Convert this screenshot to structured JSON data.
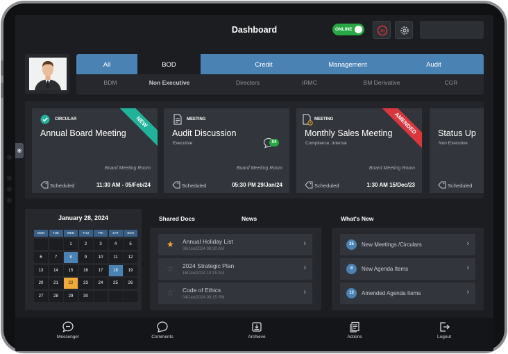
{
  "header": {
    "title": "Dashboard",
    "status_label": "ONLINE"
  },
  "filters": {
    "tabs": [
      "All",
      "BOD",
      "Credit",
      "Management",
      "Audit"
    ],
    "active_tab": "BOD",
    "subtabs": [
      "BDM",
      "Non Executive",
      "Directors",
      "IRMC",
      "BM Derivative",
      "CGR"
    ],
    "active_subtab": "Non Executive"
  },
  "cards": [
    {
      "type": "CIRCULAR",
      "title": "Annual Board Meeting",
      "subtitle": "",
      "room": "Board Meeting Room",
      "status": "Scheduled",
      "datetime": "11:30 AM - 05/Feb/24",
      "ribbon": "NEW",
      "ribbon_color": "#20b39a"
    },
    {
      "type": "MEETING",
      "title": "Audit Discussion",
      "subtitle": "Executive",
      "room": "Board Meeting Room",
      "status": "Scheduled",
      "datetime": "05:30 PM 29/Jan/24",
      "comment_count": "04"
    },
    {
      "type": "MEETING",
      "title": "Monthly Sales Meeting",
      "subtitle": "Compliance, Internal",
      "room": "Board Meeting Room",
      "status": "Scheduled",
      "datetime": "1:30 AM 15/Dec/23",
      "ribbon": "AMENDED",
      "ribbon_color": "#d9363e"
    },
    {
      "type": "",
      "title": "Status Up",
      "subtitle": "Non Executive",
      "room": "",
      "status": "Scheduled",
      "datetime": ""
    }
  ],
  "calendar": {
    "title": "January 28, 2024",
    "weekdays": [
      "MON",
      "TUE",
      "WED",
      "THU",
      "FRI",
      "SAT",
      "SUN"
    ],
    "weeks": [
      [
        "",
        "",
        "1",
        "2",
        "3",
        "4",
        "5"
      ],
      [
        "6",
        "7",
        "8",
        "9",
        "10",
        "11",
        "12"
      ],
      [
        "13",
        "14",
        "15",
        "16",
        "17",
        "18",
        "19"
      ],
      [
        "20",
        "21",
        "22",
        "23",
        "24",
        "25",
        "26"
      ],
      [
        "27",
        "28",
        "29",
        "30",
        "",
        "",
        ""
      ]
    ],
    "highlighted": [
      "8",
      "18"
    ],
    "today": "22"
  },
  "docs": {
    "tabs": [
      "Shared Docs",
      "News"
    ],
    "items": [
      {
        "name": "Annual Holiday List",
        "date": "06/Jan/2024 08:30 AM",
        "starred": true
      },
      {
        "name": "2024 Strategic Plan",
        "date": "16/Jan/2024 10:15 AM",
        "starred": false
      },
      {
        "name": "Code of Ethics",
        "date": "04/Jan/2024 08:15 PM",
        "starred": false
      }
    ]
  },
  "whats_new": {
    "title": "What's New",
    "items": [
      {
        "count": "25",
        "label": "New Meetings /Circulars"
      },
      {
        "count": "8",
        "label": "New Agenda Items"
      },
      {
        "count": "13",
        "label": "Amended Agenda Items"
      }
    ]
  },
  "nav": {
    "items": [
      {
        "label": "Messenger",
        "icon": "chat-bubble-icon"
      },
      {
        "label": "Comments",
        "icon": "comments-icon"
      },
      {
        "label": "Archieve",
        "icon": "archive-icon"
      },
      {
        "label": "Actions",
        "icon": "actions-icon"
      },
      {
        "label": "Logout",
        "icon": "logout-icon"
      }
    ]
  },
  "colors": {
    "accent": "#4a82b4",
    "online": "#27a844",
    "today": "#f0a93b"
  }
}
